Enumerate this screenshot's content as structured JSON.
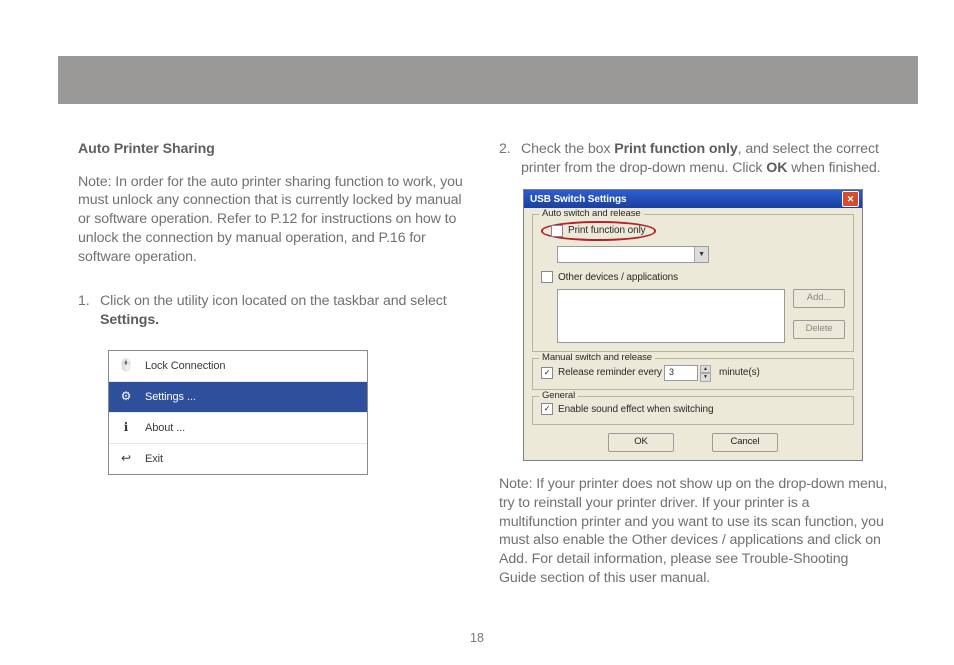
{
  "page_number": "18",
  "left": {
    "heading": "Auto Printer Sharing",
    "note": "Note: In order for the auto printer sharing function to work, you must unlock any connection that is currently locked by manual or software operation. Refer to P.12 for instructions on how to unlock the connection by manual operation, and P.16 for software operation.",
    "step1_num": "1.",
    "step1_a": "Click on the utility icon located on the taskbar and select ",
    "step1_bold": "Settings.",
    "menu": {
      "items": [
        {
          "label": "Lock Connection",
          "selected": false,
          "icon": "lock-icon"
        },
        {
          "label": "Settings ...",
          "selected": true,
          "icon": "gear-icon"
        },
        {
          "label": "About ...",
          "selected": false,
          "icon": "info-icon"
        },
        {
          "label": "Exit",
          "selected": false,
          "icon": "exit-icon"
        }
      ]
    }
  },
  "right": {
    "step2_num": "2.",
    "step2_a": "Check the box ",
    "step2_bold1": "Print function only",
    "step2_b": ", and select the correct printer from the drop-down menu. Click ",
    "step2_bold2": "OK",
    "step2_c": " when finished.",
    "dialog": {
      "title": "USB Switch Settings",
      "group_auto": "Auto switch and release",
      "cb_print": "Print function only",
      "cb_other": "Other devices / applications",
      "btn_add": "Add...",
      "btn_delete": "Delete",
      "group_manual": "Manual switch and release",
      "cb_reminder": "Release reminder every",
      "reminder_value": "3",
      "reminder_unit": "minute(s)",
      "group_general": "General",
      "cb_sound": "Enable sound effect when switching",
      "btn_ok": "OK",
      "btn_cancel": "Cancel"
    },
    "note2": "Note: If your printer does not show up on the drop-down menu, try to reinstall your printer driver.  If your printer is a multifunction printer and you want to use its scan function, you must also enable the Other devices / applications and click on Add.  For detail information, please see Trouble-Shooting Guide section of this user manual."
  }
}
